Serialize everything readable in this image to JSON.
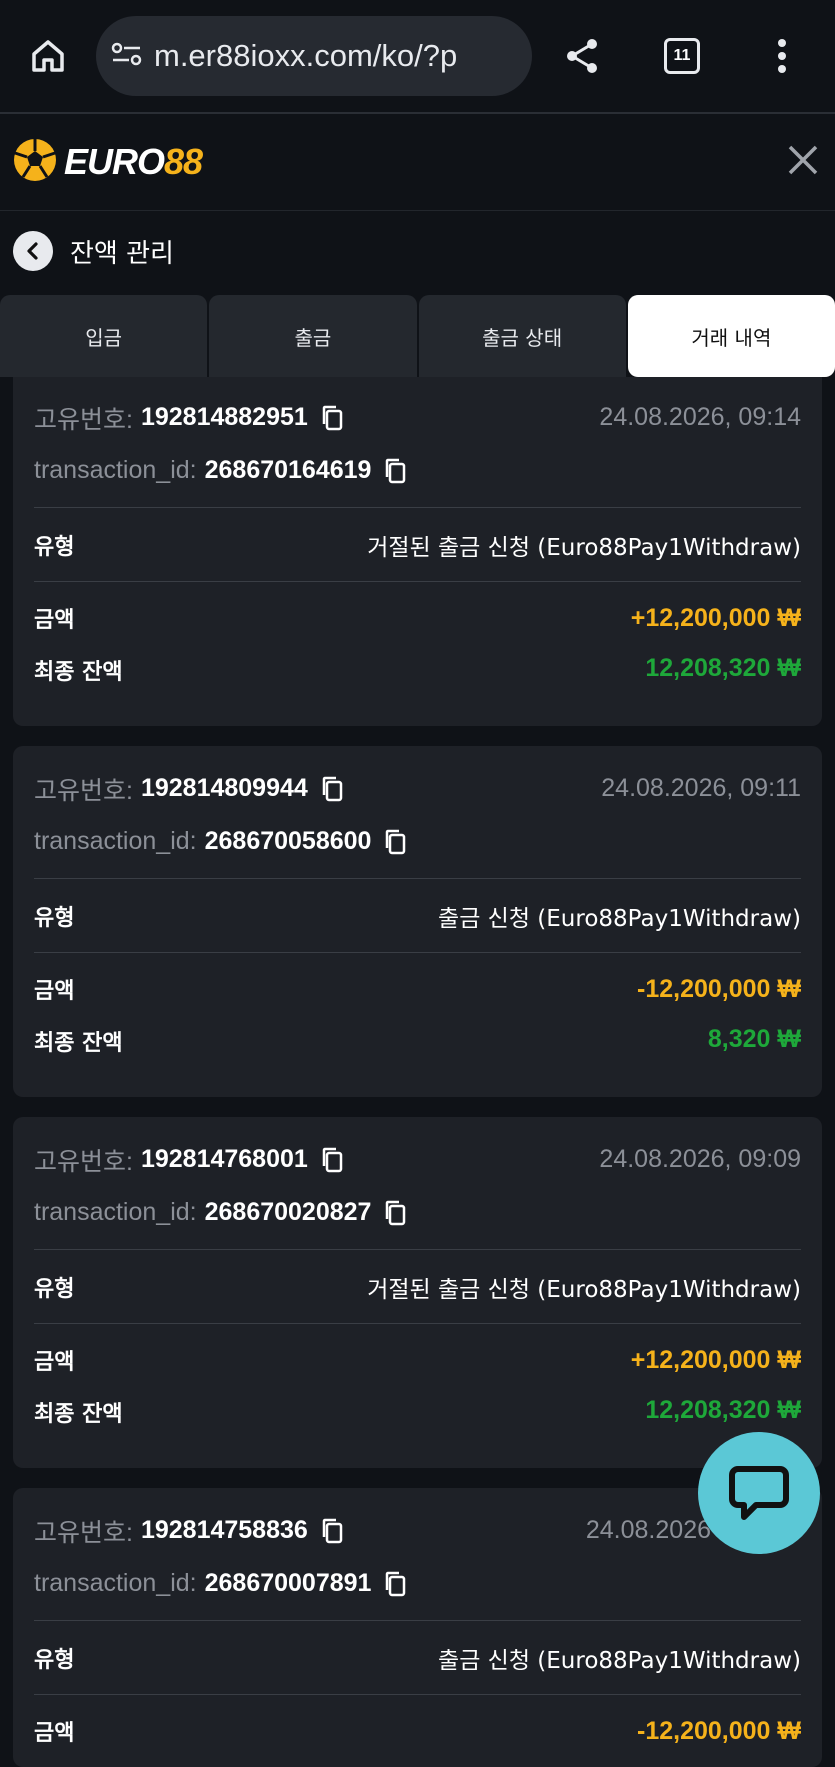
{
  "browser": {
    "url": "m.er88ioxx.com/ko/?p",
    "tab_count": "11"
  },
  "app": {
    "logo_part1": "EURO",
    "logo_part2": "88",
    "subheader_title": "잔액 관리"
  },
  "tabs": [
    {
      "label": "입금"
    },
    {
      "label": "출금"
    },
    {
      "label": "출금 상태"
    },
    {
      "label": "거래 내역"
    }
  ],
  "labels": {
    "unique_id": "고유번호:",
    "transaction_id": "transaction_id:",
    "type": "유형",
    "amount": "금액",
    "final_balance": "최종 잔액"
  },
  "transactions": [
    {
      "unique_id": "192814882951",
      "date": "24.08.2026, 09:14",
      "transaction_id": "268670164619",
      "type": "거절된 출금 신청 (Euro88Pay1Withdraw)",
      "amount": "+12,200,000 ₩",
      "balance": "12,208,320 ₩"
    },
    {
      "unique_id": "192814809944",
      "date": "24.08.2026, 09:11",
      "transaction_id": "268670058600",
      "type": "출금 신청 (Euro88Pay1Withdraw)",
      "amount": "-12,200,000 ₩",
      "balance": "8,320 ₩"
    },
    {
      "unique_id": "192814768001",
      "date": "24.08.2026, 09:09",
      "transaction_id": "268670020827",
      "type": "거절된 출금 신청 (Euro88Pay1Withdraw)",
      "amount": "+12,200,000 ₩",
      "balance": "12,208,320 ₩"
    },
    {
      "unique_id": "192814758836",
      "date": "24.08.2026",
      "transaction_id": "268670007891",
      "type": "출금 신청 (Euro88Pay1Withdraw)",
      "amount": "-12,200,000 ₩",
      "balance": ""
    }
  ],
  "colors": {
    "accent_yellow": "#f5b21b",
    "balance_green": "#1ea83a",
    "chat_button": "#5bc8d6"
  }
}
